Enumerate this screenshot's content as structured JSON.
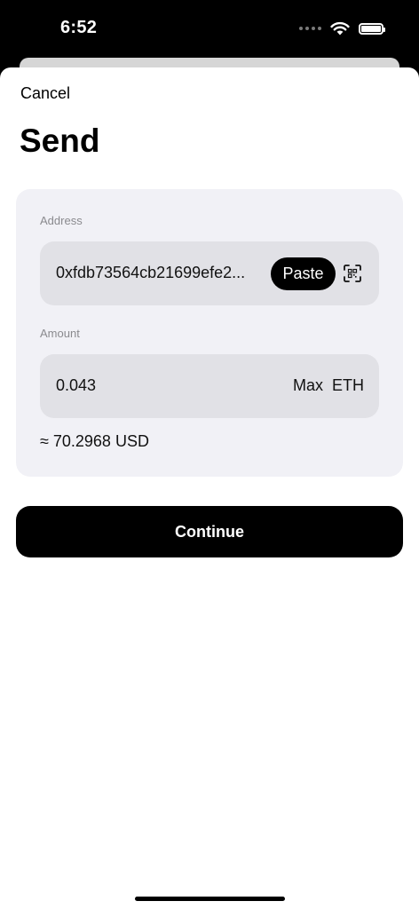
{
  "status_bar": {
    "time": "6:52",
    "icons": [
      "signal-icon",
      "wifi-icon",
      "battery-icon"
    ]
  },
  "header": {
    "cancel_label": "Cancel",
    "title": "Send"
  },
  "form": {
    "address": {
      "label": "Address",
      "value": "0xfdb73564cb21699efe2...",
      "paste_label": "Paste",
      "scan_icon": "qr-scan-icon"
    },
    "amount": {
      "label": "Amount",
      "value": "0.043",
      "max_label": "Max",
      "currency": "ETH"
    },
    "fiat_estimate": "≈ 70.2968 USD"
  },
  "actions": {
    "continue_label": "Continue"
  },
  "colors": {
    "primary": "#000000",
    "card_background": "#f1f1f6",
    "field_background": "#e1e1e6",
    "label_gray": "#8a8a8e"
  }
}
